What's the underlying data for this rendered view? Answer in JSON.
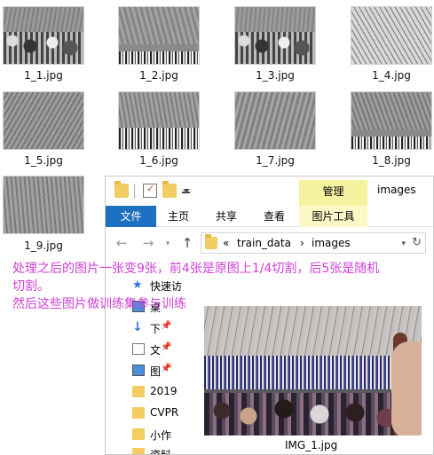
{
  "thumbnails": [
    {
      "label": "1_1.jpg"
    },
    {
      "label": "1_2.jpg"
    },
    {
      "label": "1_3.jpg"
    },
    {
      "label": "1_4.jpg"
    },
    {
      "label": "1_5.jpg"
    },
    {
      "label": "1_6.jpg"
    },
    {
      "label": "1_7.jpg"
    },
    {
      "label": "1_8.jpg"
    },
    {
      "label": "1_9.jpg"
    }
  ],
  "window": {
    "title": "images",
    "manage_tab": "管理",
    "ribbon_tabs": [
      "文件",
      "主页",
      "共享",
      "查看",
      "图片工具"
    ],
    "address": {
      "chevrons": "«",
      "segment1": "train_data",
      "separator": "›",
      "segment2": "images"
    },
    "nav_items": [
      {
        "label": "快速访",
        "icon": "star-icon"
      },
      {
        "label": "桌",
        "icon": "desktop-icon"
      },
      {
        "label": "下",
        "icon": "download-icon"
      },
      {
        "label": "文",
        "icon": "document-icon"
      },
      {
        "label": "图",
        "icon": "pictures-icon"
      },
      {
        "label": "2019",
        "icon": "folder-icon"
      },
      {
        "label": "CVPR",
        "icon": "folder-icon"
      },
      {
        "label": "小作",
        "icon": "folder-icon"
      },
      {
        "label": "资料",
        "icon": "folder-icon"
      }
    ],
    "preview_filename": "IMG_1.jpg"
  },
  "annotation": {
    "line1": "处理之后的图片一张变9张，前4张是原图上1/4切割，后5张是随机",
    "line2": "切割。",
    "line3": "然后这些图片做训练集参与训练"
  },
  "colors": {
    "annotation": "#d13fd8",
    "file_tab": "#1d6fc0",
    "manage_tab": "#f6f3a0",
    "folder": "#f3cd63"
  }
}
